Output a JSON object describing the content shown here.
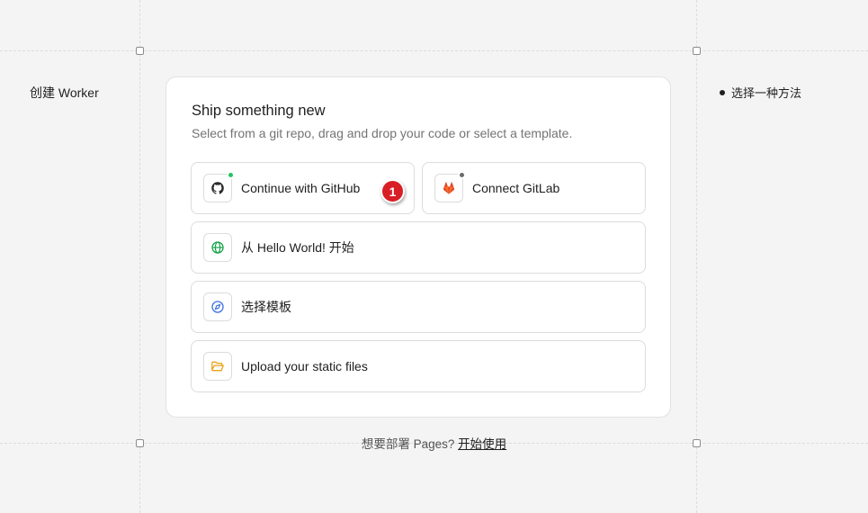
{
  "side": {
    "left_label": "创建 Worker",
    "right_step": "选择一种方法"
  },
  "card": {
    "title": "Ship something new",
    "subtitle": "Select from a git repo, drag and drop your code or select a template.",
    "options": {
      "github": {
        "label": "Continue with GitHub",
        "icon": "github-icon",
        "status_color": "#22c55e"
      },
      "gitlab": {
        "label": "Connect GitLab",
        "icon": "gitlab-icon",
        "status_color": "#6b6b6b"
      },
      "hello": {
        "label": "从 Hello World! 开始",
        "icon": "globe-icon"
      },
      "template": {
        "label": "选择模板",
        "icon": "compass-icon"
      },
      "upload": {
        "label": "Upload your static files",
        "icon": "folder-open-icon"
      }
    }
  },
  "annotation": {
    "badge": "1"
  },
  "footer": {
    "text": "想要部署 Pages?",
    "link": "开始使用"
  },
  "colors": {
    "accent_badge": "#d81f26",
    "gitlab_orange": "#e24329",
    "globe_green": "#16a34a",
    "compass_blue": "#3b6fe0",
    "folder_yellow": "#e8a317"
  }
}
